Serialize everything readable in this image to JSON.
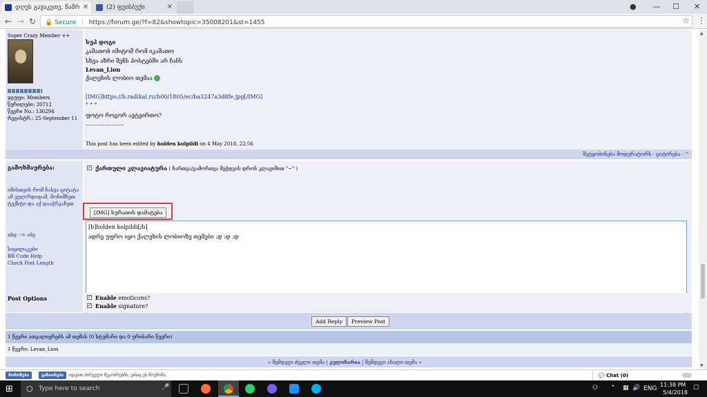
{
  "browser": {
    "tabs": [
      {
        "label": "დღეს გავაკეთე, წაშრ"
      },
      {
        "label": "(2) ფეისბუქი"
      }
    ],
    "address": {
      "secure_label": "Secure",
      "url": "https://forum.ge/?f=82&showtopic=35008201&st=1455"
    }
  },
  "post": {
    "author_rank": "Super Crazy Member ++",
    "author_group": "ჯგუფი: Members",
    "author_posts": "წერილები: 20712",
    "author_no": "წევრი No.: 136294",
    "author_reg": "რეგისტრ.: 25-September 11",
    "body": {
      "line1": "სუპ დოგი",
      "line2": "კამათობ იმიტომ რომ იკამათო",
      "line3": "სხვა აზრი შენს პოსტებში არ ჩანს",
      "line4": "Levan_Lion",
      "line5": "ქალეხის ლობიო თემაა",
      "img": "[IMG]https://b.radikal.ru/b00/1805/ec/ba3247a3d8fe.jpg[/IMG]",
      "quote_end": "\" \" \"",
      "question": "ფოტო როგორ აეტვირთო?",
      "dots": "......................"
    },
    "edited_prefix": "This post has been edited by",
    "edited_by": "holden kolpildi",
    "edited_suffix": "on 4 May 2018, 22:56",
    "actions": "შეტყობინება მოდერატორს · ციტირება · ^"
  },
  "reply": {
    "label": "გამოხმაურება:",
    "georgian_keyboard": "ქართული კლავიატურა",
    "keyboard_hint": "( ჩართვა/გამორთვა მეჭდვის დროს კლავიშით \"~\" )",
    "img_button": "[IMG] სურათის დამატება",
    "side_note": "იმისთვის რომ ჩასვა ციტატა ამ ველ(რდიდამ, მონიშნეთ ტექსტი და აქ დააჭრკაჩეთ",
    "abg": "abg --> აბგ",
    "emoticons": "სიცილაკები",
    "bb_help": "BB Code Help",
    "check_length": "Check Post Length",
    "text_line1": "[b]holden kolpildi[/b]",
    "text_line2": "ადრე უფრო იყო ქალეხის ლობიოზე თემები :დ :დ :დ"
  },
  "options": {
    "label": "Post Options",
    "enable_emoticons_bold": "Enable",
    "enable_emoticons": "emoticons?",
    "enable_signature_bold": "Enable",
    "enable_signature": "signature?"
  },
  "buttons": {
    "add_reply": "Add Reply",
    "preview": "Preview Post"
  },
  "readers": "1 წევრი ათვალიერებს ამ თემას (0 სტუმარი და 0 ურიბარი წევრი)",
  "members_online": "1 წევრი: Levan_Lion",
  "nav": {
    "prev": "« შემდეგი ძველი თემა",
    "sep": "|",
    "current": "კულინარია",
    "next": "შემდეგი ახალი თემა »"
  },
  "fb": {
    "like": "მოწონება",
    "share": "გაზიარება",
    "text": "იყავით პირველი მეგობრებში, ვისაც ეს მოეწონა."
  },
  "chat": "Chat (0)",
  "taskbar": {
    "search": "Type here to search",
    "lang": "ENG",
    "time": "11:38 PM",
    "date": "5/4/2018"
  }
}
